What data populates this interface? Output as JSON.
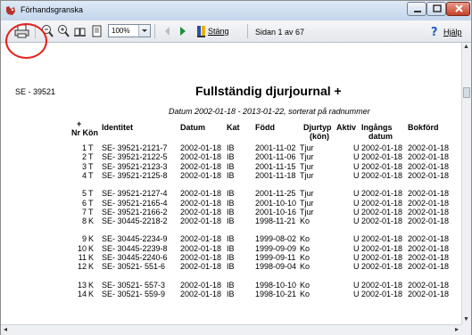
{
  "window": {
    "title": "Förhandsgranska",
    "controls": [
      "minimize",
      "maximize",
      "close"
    ]
  },
  "toolbar": {
    "zoom_value": "100%",
    "close_label": "Stäng",
    "page_info": "Sidan 1 av 67",
    "help_label": "Hjälp",
    "icons": [
      "printer-icon",
      "zoom-in-icon",
      "zoom-out-icon",
      "single-page-icon",
      "multi-page-icon",
      "prev-page-icon",
      "next-page-icon",
      "close-book-icon",
      "help-icon"
    ]
  },
  "highlight_color": "#e2221c",
  "report": {
    "id": "SE - 39521",
    "title": "Fullständig djurjournal +",
    "subtitle": "Datum 2002-01-18 - 2013-01-22, sorterat på radnummer",
    "headers": {
      "plus": "+",
      "nr_kon": "Nr Kön",
      "identitet": "Identitet",
      "datum": "Datum",
      "kat": "Kat",
      "fodd": "Född",
      "djurtyp": "Djurtyp",
      "djurtyp_sub": "(kön)",
      "aktiv": "Aktiv",
      "ingangs": "Ingångs",
      "ingangs_sub": "datum",
      "bokford": "Bokförd"
    },
    "rows": [
      {
        "nr": "1",
        "kon": "T",
        "id": "SE- 39521-2121-7",
        "datum": "2002-01-18",
        "kat": "IB",
        "fodd": "2001-11-02",
        "djurtyp": "Tjur",
        "aktiv": "U",
        "ing": "2002-01-18",
        "bok": "2002-01-18"
      },
      {
        "nr": "2",
        "kon": "T",
        "id": "SE- 39521-2122-5",
        "datum": "2002-01-18",
        "kat": "IB",
        "fodd": "2001-11-06",
        "djurtyp": "Tjur",
        "aktiv": "U",
        "ing": "2002-01-18",
        "bok": "2002-01-18"
      },
      {
        "nr": "3",
        "kon": "T",
        "id": "SE- 39521-2123-3",
        "datum": "2002-01-18",
        "kat": "IB",
        "fodd": "2001-11-15",
        "djurtyp": "Tjur",
        "aktiv": "U",
        "ing": "2002-01-18",
        "bok": "2002-01-18"
      },
      {
        "nr": "4",
        "kon": "T",
        "id": "SE- 39521-2125-8",
        "datum": "2002-01-18",
        "kat": "IB",
        "fodd": "2001-11-18",
        "djurtyp": "Tjur",
        "aktiv": "U",
        "ing": "2002-01-18",
        "bok": "2002-01-18"
      },
      {
        "nr": "5",
        "kon": "T",
        "id": "SE- 39521-2127-4",
        "datum": "2002-01-18",
        "kat": "IB",
        "fodd": "2001-11-25",
        "djurtyp": "Tjur",
        "aktiv": "U",
        "ing": "2002-01-18",
        "bok": "2002-01-18"
      },
      {
        "nr": "6",
        "kon": "T",
        "id": "SE- 39521-2165-4",
        "datum": "2002-01-18",
        "kat": "IB",
        "fodd": "2001-10-10",
        "djurtyp": "Tjur",
        "aktiv": "U",
        "ing": "2002-01-18",
        "bok": "2002-01-18"
      },
      {
        "nr": "7",
        "kon": "T",
        "id": "SE- 39521-2166-2",
        "datum": "2002-01-18",
        "kat": "IB",
        "fodd": "2001-10-16",
        "djurtyp": "Tjur",
        "aktiv": "U",
        "ing": "2002-01-18",
        "bok": "2002-01-18"
      },
      {
        "nr": "8",
        "kon": "K",
        "id": "SE- 30445-2218-2",
        "datum": "2002-01-18",
        "kat": "IB",
        "fodd": "1998-11-21",
        "djurtyp": "Ko",
        "aktiv": "U",
        "ing": "2002-01-18",
        "bok": "2002-01-18"
      },
      {
        "nr": "9",
        "kon": "K",
        "id": "SE- 30445-2234-9",
        "datum": "2002-01-18",
        "kat": "IB",
        "fodd": "1999-08-02",
        "djurtyp": "Ko",
        "aktiv": "U",
        "ing": "2002-01-18",
        "bok": "2002-01-18"
      },
      {
        "nr": "10",
        "kon": "K",
        "id": "SE- 30445-2239-8",
        "datum": "2002-01-18",
        "kat": "IB",
        "fodd": "1999-09-09",
        "djurtyp": "Ko",
        "aktiv": "U",
        "ing": "2002-01-18",
        "bok": "2002-01-18"
      },
      {
        "nr": "11",
        "kon": "K",
        "id": "SE- 30445-2240-6",
        "datum": "2002-01-18",
        "kat": "IB",
        "fodd": "1999-09-11",
        "djurtyp": "Ko",
        "aktiv": "U",
        "ing": "2002-01-18",
        "bok": "2002-01-18"
      },
      {
        "nr": "12",
        "kon": "K",
        "id": "SE- 30521- 551-6",
        "datum": "2002-01-18",
        "kat": "IB",
        "fodd": "1998-09-04",
        "djurtyp": "Ko",
        "aktiv": "U",
        "ing": "2002-01-18",
        "bok": "2002-01-18"
      },
      {
        "nr": "13",
        "kon": "K",
        "id": "SE- 30521- 557-3",
        "datum": "2002-01-18",
        "kat": "IB",
        "fodd": "1998-10-10",
        "djurtyp": "Ko",
        "aktiv": "U",
        "ing": "2002-01-18",
        "bok": "2002-01-18"
      },
      {
        "nr": "14",
        "kon": "K",
        "id": "SE- 30521- 559-9",
        "datum": "2002-01-18",
        "kat": "IB",
        "fodd": "1998-10-21",
        "djurtyp": "Ko",
        "aktiv": "U",
        "ing": "2002-01-18",
        "bok": "2002-01-18"
      }
    ]
  }
}
